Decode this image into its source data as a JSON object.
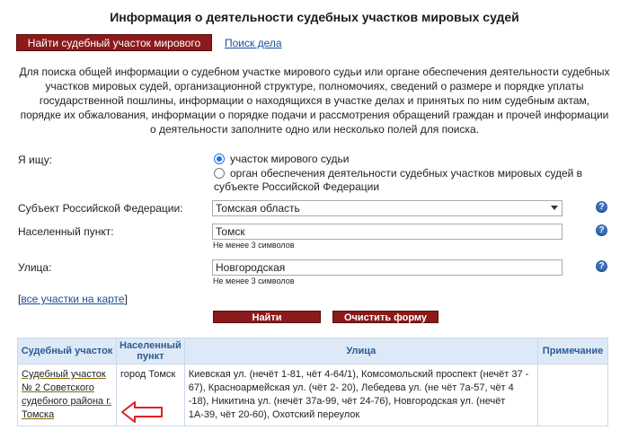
{
  "header": {
    "title": "Информация о деятельности судебных участков мировых судей"
  },
  "tabs": {
    "active": "Найти судебный участок мирового судьи",
    "link": "Поиск дела"
  },
  "description": "Для поиска общей информации о судебном участке мирового судьи или органе обеспечения деятельности судебных участков мировых судей, организационной структуре, полномочиях, сведений о размере и порядке уплаты государственной пошлины, информации о находящихся в участке делах и принятых по ним судебным актам, порядке их обжалования, информации о порядке подачи и рассмотрения обращений граждан и прочей информации о деятельности заполните одно или несколько полей для поиска.",
  "form": {
    "search_label": "Я ищу:",
    "radio1": "участок мирового судьи",
    "radio2_line1": "орган обеспечения деятельности судебных участков мировых судей в",
    "radio2_line2": "субъекте Российской Федерации",
    "subject_label": "Субъект Российской Федерации:",
    "subject_value": "Томская область",
    "city_label": "Населенный пункт:",
    "city_value": "Томск",
    "city_hint": "Не менее 3 символов",
    "street_label": "Улица:",
    "street_value": "Новгородская",
    "street_hint": "Не менее 3 символов",
    "help_glyph": "?",
    "map_bracket_open": "[",
    "map_link": "все участки на карте",
    "map_bracket_close": "]",
    "find_button": "Найти",
    "clear_button": "Очистить форму"
  },
  "table": {
    "headers": {
      "court": "Судебный участок",
      "city_line1": "Населенный",
      "city_line2": "пункт",
      "street": "Улица",
      "note": "Примечание"
    },
    "rows": [
      {
        "court_l1": "Судебный участок",
        "court_l2": "№ 2 Советского",
        "court_l3": "судебного района г.",
        "court_l4": "Томска",
        "city": "город Томск",
        "street": "Киевская ул. (нечёт 1-81, чёт 4-64/1), Комсомольский проспект (нечёт 37 - 67), Красноармейская ул. (чёт 2- 20), Лебедева ул. (не чёт 7а-57, чёт 4 -18), Никитина ул. (нечёт 37а-99, чёт 24-76), Новгородская ул. (нечёт 1А-39, чёт 20-60), Охотский переулок",
        "note": ""
      }
    ]
  },
  "colors": {
    "accent": "#8b1a1a",
    "header_bg": "#dde9f6",
    "link": "#1a4fa0",
    "annotation_arrow": "#e02020"
  }
}
